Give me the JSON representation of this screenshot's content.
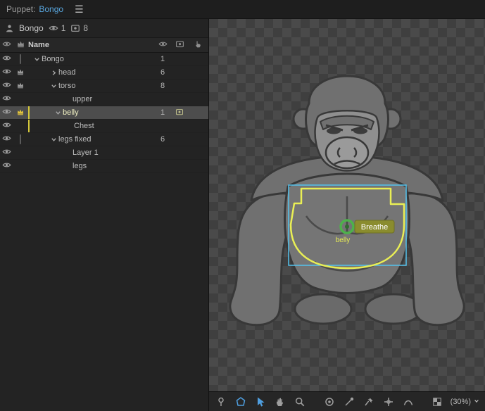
{
  "titlebar": {
    "panel_label": "Puppet:",
    "puppet_name": "Bongo"
  },
  "summary": {
    "name": "Bongo",
    "visible_count": "1",
    "frame_count": "8"
  },
  "tree": {
    "name_header": "Name",
    "rows": [
      {
        "label": "Bongo",
        "depth": 0,
        "expand": "open",
        "thumb": "square",
        "count": "1",
        "selected": false,
        "tag": false,
        "camera": false
      },
      {
        "label": "head",
        "depth": 1,
        "expand": "closed",
        "thumb": "crown",
        "count": "6",
        "selected": false,
        "tag": false,
        "camera": false
      },
      {
        "label": "torso",
        "depth": 1,
        "expand": "open",
        "thumb": "crown",
        "count": "8",
        "selected": false,
        "tag": false,
        "camera": false
      },
      {
        "label": "upper",
        "depth": 3,
        "expand": "none",
        "thumb": "none",
        "count": "",
        "selected": false,
        "tag": false,
        "camera": false
      },
      {
        "label": "belly",
        "depth": 2,
        "expand": "open",
        "thumb": "crown-yellow",
        "count": "1",
        "selected": true,
        "tag": true,
        "camera": true
      },
      {
        "label": "Chest",
        "depth": 3,
        "expand": "none",
        "thumb": "none",
        "count": "",
        "selected": false,
        "tag": true,
        "camera": false
      },
      {
        "label": "legs fixed",
        "depth": 1,
        "expand": "open",
        "thumb": "square",
        "count": "6",
        "selected": false,
        "tag": false,
        "camera": false
      },
      {
        "label": "Layer 1",
        "depth": 3,
        "expand": "none",
        "thumb": "none",
        "count": "",
        "selected": false,
        "tag": false,
        "camera": false
      },
      {
        "label": "legs",
        "depth": 3,
        "expand": "none",
        "thumb": "none",
        "count": "",
        "selected": false,
        "tag": false,
        "camera": false
      }
    ]
  },
  "canvas": {
    "handle_badge": "Breathe",
    "handle_name": "belly"
  },
  "toolbar": {
    "tools": [
      {
        "name": "mesh-pin-tool",
        "icon": "pin",
        "group": 1,
        "accent": false,
        "selected": false
      },
      {
        "name": "outline-tool",
        "icon": "polygon",
        "group": 1,
        "accent": true,
        "selected": false
      },
      {
        "name": "selection-tool",
        "icon": "arrow",
        "group": 1,
        "accent": true,
        "selected": true
      },
      {
        "name": "hand-tool",
        "icon": "hand",
        "group": 1,
        "accent": false,
        "selected": false
      },
      {
        "name": "zoom-tool",
        "icon": "magnifier",
        "group": 1,
        "accent": false,
        "selected": false
      },
      {
        "name": "handle-tool",
        "icon": "target",
        "group": 2,
        "accent": false,
        "selected": false
      },
      {
        "name": "stick-tool",
        "icon": "needle",
        "group": 2,
        "accent": false,
        "selected": false
      },
      {
        "name": "pin-tool",
        "icon": "pushpin",
        "group": 2,
        "accent": false,
        "selected": false
      },
      {
        "name": "origin-tool",
        "icon": "crosshair",
        "group": 2,
        "accent": false,
        "selected": false
      },
      {
        "name": "dangle-tool",
        "icon": "curve",
        "group": 2,
        "accent": false,
        "selected": false
      }
    ],
    "zoom_label": "(30%)"
  },
  "colors": {
    "accent_blue": "#4f9fe0",
    "selection_cyan": "#55c3ee",
    "outline_yellow": "#e9ee55",
    "handle_green": "#4db14b",
    "badge_olive": "#8a8c2e",
    "crown_yellow": "#e3c43c"
  }
}
